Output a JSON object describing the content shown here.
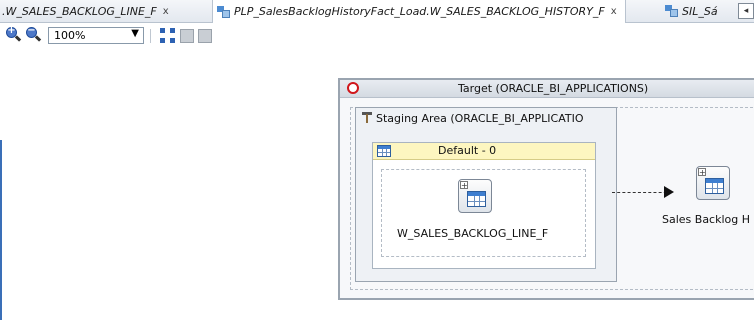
{
  "tabs": [
    {
      "label": ".W_SALES_BACKLOG_LINE_F",
      "close": "x"
    },
    {
      "label": "PLP_SalesBacklogHistoryFact_Load.W_SALES_BACKLOG_HISTORY_F",
      "close": "x"
    },
    {
      "label": "SIL_Sá"
    }
  ],
  "tab_nav_glyph": "◂",
  "toolbar": {
    "zoom_in_icon": "zoom-in-icon",
    "zoom_out_icon": "zoom-out-icon",
    "zoom_value": "100%",
    "fit_icon": "fit-to-window-icon"
  },
  "diagram": {
    "target_title": "Target (ORACLE_BI_APPLICATIONS)",
    "staging_title": "Staging Area (ORACLE_BI_APPLICATIO",
    "default_group": "Default - 0",
    "source_node": "W_SALES_BACKLOG_LINE_F",
    "target_node": "Sales Backlog H",
    "plus_glyph": "+"
  },
  "colors": {
    "oracle_red": "#d0161b",
    "group_header": "#fdf6c0",
    "tab_accent": "#4c8bd1"
  }
}
